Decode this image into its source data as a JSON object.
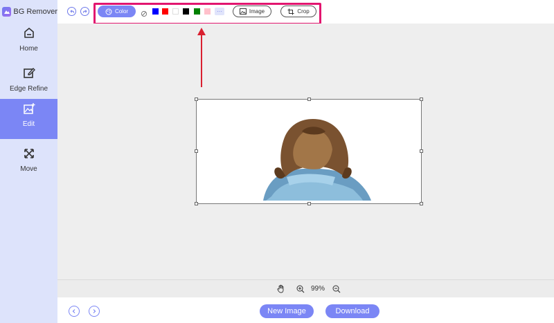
{
  "app": {
    "title": "BG Remover"
  },
  "sidebar": {
    "items": [
      {
        "label": "Home",
        "icon": "home-icon",
        "active": false
      },
      {
        "label": "Edge Refine",
        "icon": "edit-pencil-icon",
        "active": false
      },
      {
        "label": "Edit",
        "icon": "image-edit-icon",
        "active": true
      },
      {
        "label": "Move",
        "icon": "move-arrows-icon",
        "active": false
      }
    ]
  },
  "toolbar": {
    "color_label": "Color",
    "swatches": [
      "none",
      "#0000ff",
      "#ff0000",
      "#ffffff",
      "#000000",
      "#008000",
      "#ffc0cb"
    ],
    "more_label": "···",
    "image_label": "Image",
    "crop_label": "Crop",
    "highlight_color": "#e2156f"
  },
  "annotation": {
    "arrow_color": "#d92030"
  },
  "zoom": {
    "value": "99%"
  },
  "footer": {
    "new_image_label": "New Image",
    "download_label": "Download"
  },
  "colors": {
    "accent": "#7b86f5",
    "sidebar_bg": "#dde3fb",
    "canvas_bg": "#eeeeee"
  }
}
